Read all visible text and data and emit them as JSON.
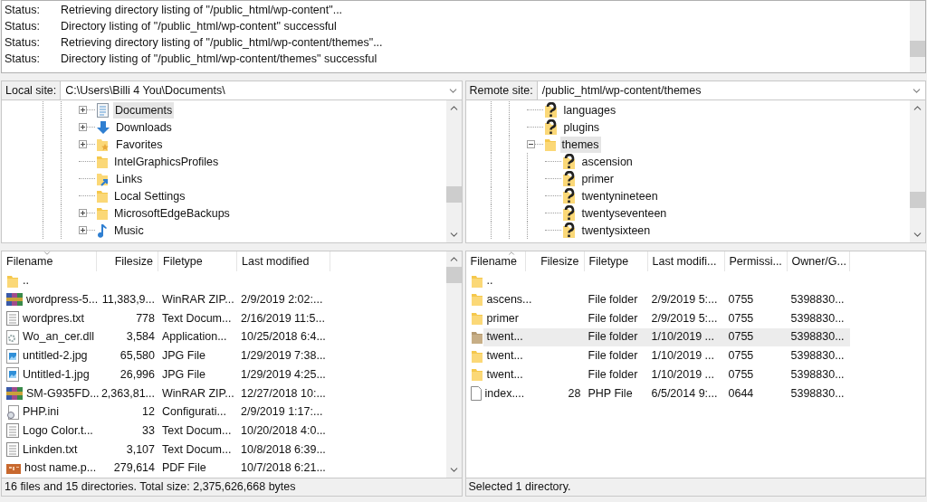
{
  "log": [
    {
      "label": "Status:",
      "message": "Retrieving directory listing of \"/public_html/wp-content\"..."
    },
    {
      "label": "Status:",
      "message": "Directory listing of \"/public_html/wp-content\" successful"
    },
    {
      "label": "Status:",
      "message": "Retrieving directory listing of \"/public_html/wp-content/themes\"..."
    },
    {
      "label": "Status:",
      "message": "Directory listing of \"/public_html/wp-content/themes\" successful"
    }
  ],
  "local": {
    "label": "Local site:",
    "path": "C:\\Users\\Billi 4 You\\Documents\\",
    "tree": [
      {
        "name": "Documents",
        "kind": "documents",
        "expanded": false,
        "selected": true
      },
      {
        "name": "Downloads",
        "kind": "download",
        "expanded": false,
        "selected": false
      },
      {
        "name": "Favorites",
        "kind": "favorites",
        "expanded": false,
        "selected": false
      },
      {
        "name": "IntelGraphicsProfiles",
        "kind": "folder",
        "selected": false
      },
      {
        "name": "Links",
        "kind": "links",
        "selected": false
      },
      {
        "name": "Local Settings",
        "kind": "folder",
        "selected": false
      },
      {
        "name": "MicrosoftEdgeBackups",
        "kind": "folder",
        "expanded": false,
        "selected": false
      },
      {
        "name": "Music",
        "kind": "music",
        "expanded": false,
        "selected": false
      }
    ],
    "columns": [
      {
        "label": "Filename",
        "sort_ascending": false
      },
      {
        "label": "Filesize"
      },
      {
        "label": "Filetype"
      },
      {
        "label": "Last modified"
      }
    ],
    "rows": [
      {
        "kind": "folder",
        "filename": "..",
        "selected": false
      },
      {
        "kind": "archive",
        "filename": "wordpress-5...",
        "filesize": "11,383,9...",
        "filetype": "WinRAR ZIP...",
        "last_modified": "2/9/2019 2:02:...",
        "selected": false
      },
      {
        "kind": "text",
        "filename": "wordpres.txt",
        "filesize": "778",
        "filetype": "Text Docum...",
        "last_modified": "2/16/2019 11:5...",
        "selected": false
      },
      {
        "kind": "dll",
        "filename": "Wo_an_cer.dll",
        "filesize": "3,584",
        "filetype": "Application...",
        "last_modified": "10/25/2018 6:4...",
        "selected": false
      },
      {
        "kind": "image",
        "filename": "untitled-2.jpg",
        "filesize": "65,580",
        "filetype": "JPG File",
        "last_modified": "1/29/2019 7:38...",
        "selected": false
      },
      {
        "kind": "image",
        "filename": "Untitled-1.jpg",
        "filesize": "26,996",
        "filetype": "JPG File",
        "last_modified": "1/29/2019 4:25...",
        "selected": false
      },
      {
        "kind": "archive",
        "filename": "SM-G935FD...",
        "filesize": "2,363,81...",
        "filetype": "WinRAR ZIP...",
        "last_modified": "12/27/2018 10:...",
        "selected": false
      },
      {
        "kind": "config",
        "filename": "PHP.ini",
        "filesize": "12",
        "filetype": "Configurati...",
        "last_modified": "2/9/2019 1:17:...",
        "selected": false
      },
      {
        "kind": "text",
        "filename": "Logo Color.t...",
        "filesize": "33",
        "filetype": "Text Docum...",
        "last_modified": "10/20/2018 4:0...",
        "selected": false
      },
      {
        "kind": "text",
        "filename": "Linkden.txt",
        "filesize": "3,107",
        "filetype": "Text Docum...",
        "last_modified": "10/8/2018 6:39...",
        "selected": false
      },
      {
        "kind": "pdf",
        "filename": "host name.p...",
        "filesize": "279,614",
        "filetype": "PDF File",
        "last_modified": "10/7/2018 6:21...",
        "selected": false
      }
    ],
    "status": "16 files and 15 directories. Total size: 2,375,626,668 bytes"
  },
  "remote": {
    "label": "Remote site:",
    "path": "/public_html/wp-content/themes",
    "tree": [
      {
        "name": "languages",
        "kind": "unknown",
        "selected": false
      },
      {
        "name": "plugins",
        "kind": "unknown",
        "selected": false
      },
      {
        "name": "themes",
        "kind": "folder",
        "expanded": true,
        "selected": true,
        "children": [
          {
            "name": "ascension",
            "kind": "unknown",
            "selected": false
          },
          {
            "name": "primer",
            "kind": "unknown",
            "selected": false
          },
          {
            "name": "twentynineteen",
            "kind": "unknown",
            "selected": false
          },
          {
            "name": "twentyseventeen",
            "kind": "unknown",
            "selected": false
          },
          {
            "name": "twentysixteen",
            "kind": "unknown",
            "selected": false
          }
        ]
      }
    ],
    "columns": [
      {
        "label": "Filename",
        "sort_ascending": true
      },
      {
        "label": "Filesize"
      },
      {
        "label": "Filetype"
      },
      {
        "label": "Last modifi..."
      },
      {
        "label": "Permissi..."
      },
      {
        "label": "Owner/G..."
      }
    ],
    "rows": [
      {
        "kind": "folder",
        "filename": "..",
        "selected": false
      },
      {
        "kind": "folder",
        "filename": "ascens...",
        "filetype": "File folder",
        "last_modified": "2/9/2019 5:...",
        "permissions": "0755",
        "owner_group": "5398830...",
        "selected": false
      },
      {
        "kind": "folder",
        "filename": "primer",
        "filetype": "File folder",
        "last_modified": "2/9/2019 5:...",
        "permissions": "0755",
        "owner_group": "5398830...",
        "selected": false
      },
      {
        "kind": "folder",
        "filename": "twent...",
        "filetype": "File folder",
        "last_modified": "1/10/2019 ...",
        "permissions": "0755",
        "owner_group": "5398830...",
        "selected": true
      },
      {
        "kind": "folder",
        "filename": "twent...",
        "filetype": "File folder",
        "last_modified": "1/10/2019 ...",
        "permissions": "0755",
        "owner_group": "5398830...",
        "selected": false
      },
      {
        "kind": "folder",
        "filename": "twent...",
        "filetype": "File folder",
        "last_modified": "1/10/2019 ...",
        "permissions": "0755",
        "owner_group": "5398830...",
        "selected": false
      },
      {
        "kind": "blank",
        "filename": "index....",
        "filesize": "28",
        "filetype": "PHP File",
        "last_modified": "6/5/2014 9:...",
        "permissions": "0644",
        "owner_group": "5398830...",
        "selected": false
      }
    ],
    "status": "Selected 1 directory."
  }
}
